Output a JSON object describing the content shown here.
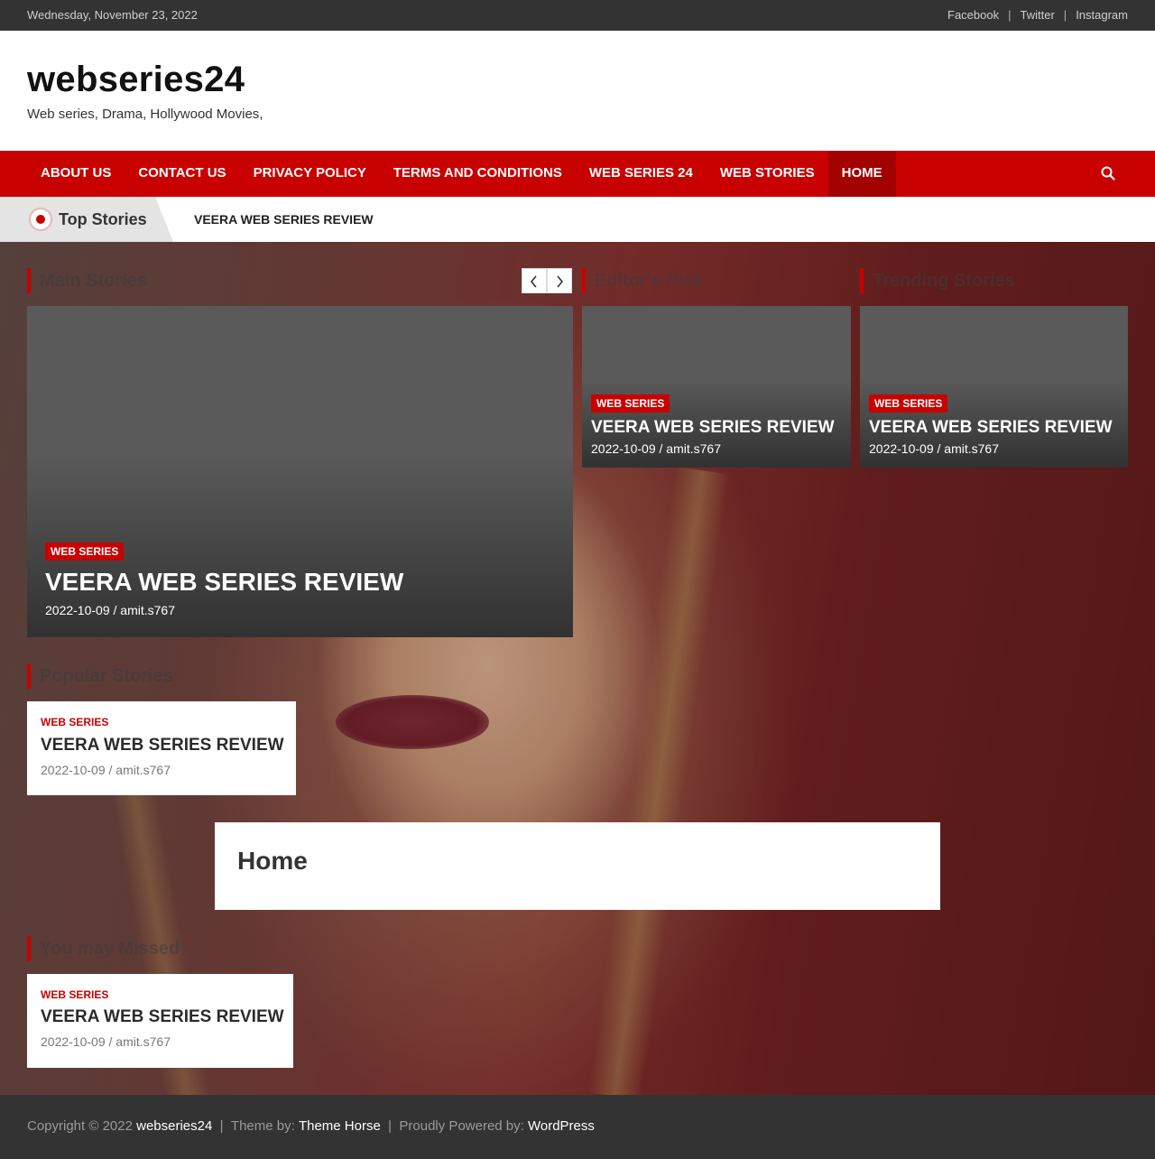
{
  "topbar": {
    "date": "Wednesday, November 23, 2022",
    "social": [
      "Facebook",
      "Twitter",
      "Instagram"
    ]
  },
  "header": {
    "site_title": "webseries24",
    "site_description": "Web series, Drama, Hollywood Movies,"
  },
  "nav": {
    "items": [
      "ABOUT US",
      "CONTACT US",
      "PRIVACY POLICY",
      "TERMS AND CONDITIONS",
      "WEB SERIES 24",
      "WEB STORIES",
      "HOME"
    ],
    "active": "HOME",
    "search_icon": "search-icon"
  },
  "ticker": {
    "label": "Top Stories",
    "headline": "VEERA WEB SERIES REVIEW"
  },
  "sections": {
    "main_stories": "Main Stories",
    "editors_pick": "Editor's Pick",
    "trending_stories": "Trending Stories",
    "popular_stories": "Popular Stories",
    "you_may_missed": "You may Missed"
  },
  "main_story": {
    "category": "WEB SERIES",
    "title": "VEERA WEB SERIES REVIEW",
    "meta": "2022-10-09 / amit.s767"
  },
  "editors_pick": {
    "category": "WEB SERIES",
    "title": "VEERA WEB SERIES REVIEW",
    "meta": "2022-10-09 / amit.s767"
  },
  "trending": {
    "category": "WEB SERIES",
    "title": "VEERA WEB SERIES REVIEW",
    "meta": "2022-10-09 / amit.s767"
  },
  "popular": {
    "category": "WEB SERIES",
    "title": "VEERA WEB SERIES REVIEW",
    "meta": "2022-10-09 / amit.s767"
  },
  "home_box": {
    "title": "Home"
  },
  "missed": {
    "category": "WEB SERIES",
    "title": "VEERA WEB SERIES REVIEW",
    "meta": "2022-10-09 / amit.s767"
  },
  "footer": {
    "copyright": "Copyright © 2022 ",
    "site": "webseries24",
    "sep1": "  |  ",
    "theme_by": "Theme by: ",
    "theme": "Theme Horse",
    "sep2": "  |  ",
    "powered_by": "Proudly Powered by: ",
    "powered": "WordPress"
  },
  "colors": {
    "accent": "#c80000",
    "dark": "#333333"
  }
}
